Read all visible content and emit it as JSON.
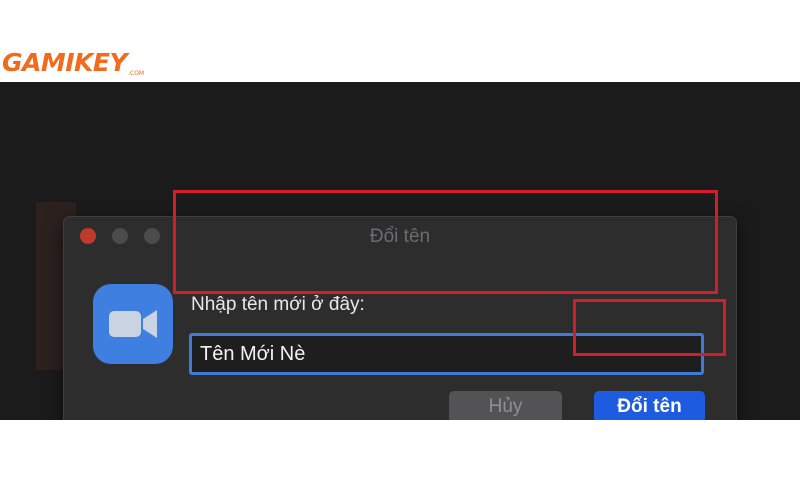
{
  "watermark": {
    "brand": "GAMIKEY",
    "domain": ".COM"
  },
  "dialog": {
    "title": "Đổi tên",
    "prompt_label": "Nhập tên mới ở đây:",
    "name_input_value": "Tên Mới Nè",
    "cancel_label": "Hủy",
    "confirm_label": "Đổi tên",
    "app_icon": "zoom-camera-icon"
  },
  "colors": {
    "highlight": "#d41d2b",
    "accent_blue": "#1d5ce0",
    "brand_orange": "#f26a1b"
  }
}
